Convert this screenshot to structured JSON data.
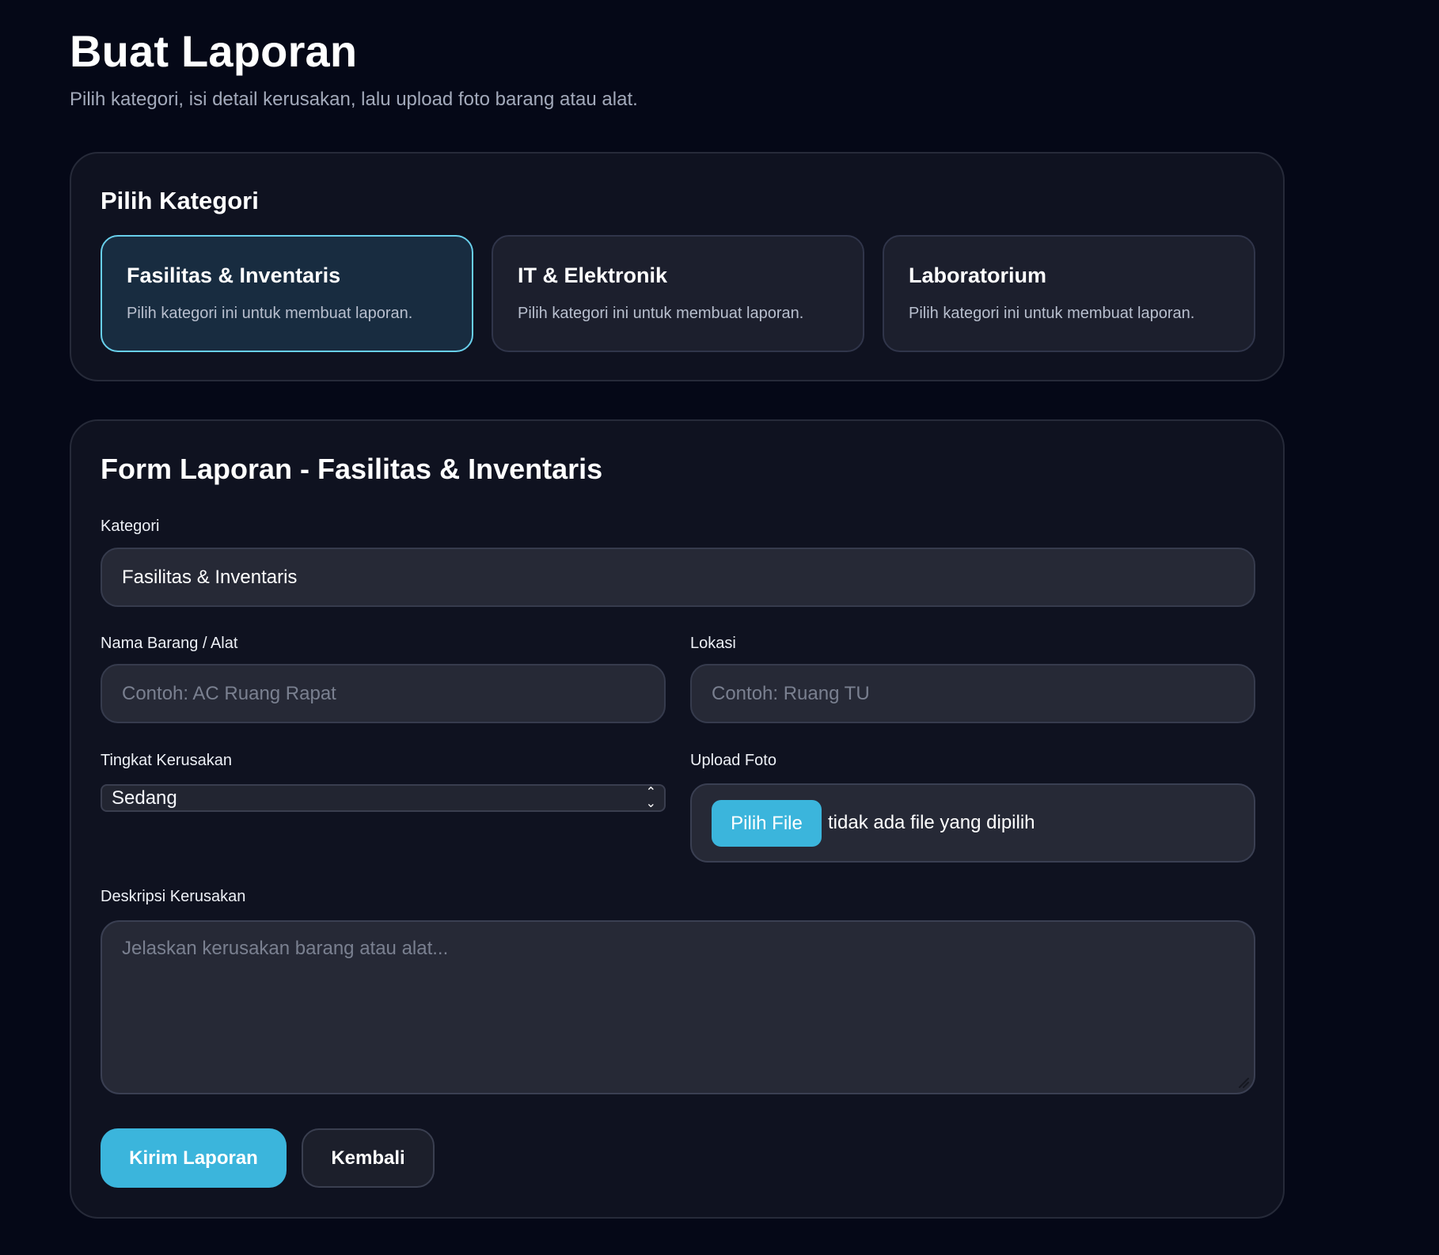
{
  "page": {
    "title": "Buat Laporan",
    "subtitle": "Pilih kategori, isi detail kerusakan, lalu upload foto barang atau alat."
  },
  "category_section": {
    "title": "Pilih Kategori",
    "cards": [
      {
        "title": "Fasilitas & Inventaris",
        "description": "Pilih kategori ini untuk membuat laporan.",
        "selected": true
      },
      {
        "title": "IT & Elektronik",
        "description": "Pilih kategori ini untuk membuat laporan.",
        "selected": false
      },
      {
        "title": "Laboratorium",
        "description": "Pilih kategori ini untuk membuat laporan.",
        "selected": false
      }
    ]
  },
  "form": {
    "title": "Form Laporan - Fasilitas & Inventaris",
    "category": {
      "label": "Kategori",
      "value": "Fasilitas & Inventaris"
    },
    "item_name": {
      "label": "Nama Barang / Alat",
      "placeholder": "Contoh: AC Ruang Rapat"
    },
    "location": {
      "label": "Lokasi",
      "placeholder": "Contoh: Ruang TU"
    },
    "damage_level": {
      "label": "Tingkat Kerusakan",
      "value": "Sedang"
    },
    "photo": {
      "label": "Upload Foto",
      "button": "Pilih File",
      "status": "tidak ada file yang dipilih"
    },
    "description": {
      "label": "Deskripsi Kerusakan",
      "placeholder": "Jelaskan kerusakan barang atau alat..."
    },
    "actions": {
      "submit": "Kirim Laporan",
      "back": "Kembali"
    }
  },
  "colors": {
    "background": "#050817",
    "panel": "#0f1220",
    "accent": "#3bb5dc",
    "selected_border": "#68cfeb"
  },
  "icons": {
    "select": "chevron-up-down-icon",
    "textarea_resize": "resize-handle-icon"
  }
}
